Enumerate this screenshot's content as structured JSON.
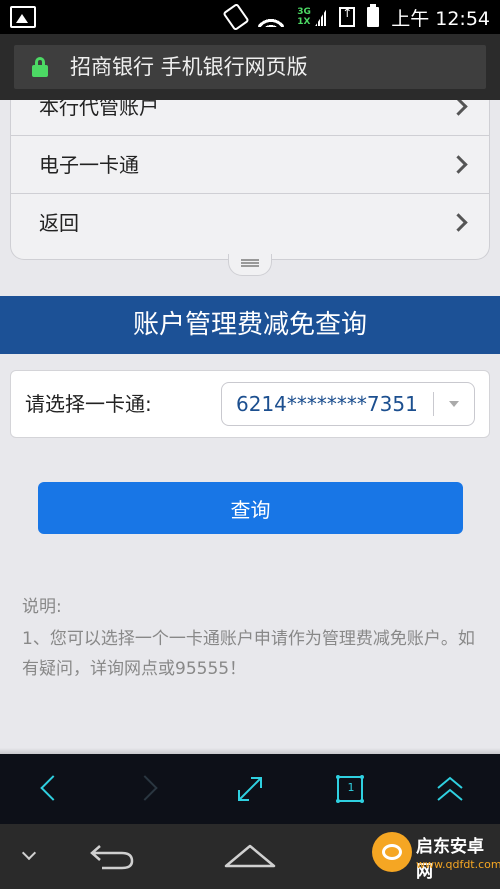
{
  "status_bar": {
    "time": "上午 12:54",
    "network_top": "3G",
    "network_bottom": "1X"
  },
  "browser": {
    "page_title": "招商银行 手机银行网页版"
  },
  "menu": {
    "items": [
      {
        "label": "本行代管账户"
      },
      {
        "label": "电子一卡通"
      },
      {
        "label": "返回"
      }
    ]
  },
  "header": {
    "title": "账户管理费减免查询"
  },
  "card_select": {
    "label": "请选择一卡通:",
    "value": "6214********7351"
  },
  "query_button": {
    "label": "查询"
  },
  "notes": {
    "title": "说明:",
    "body": "1、您可以选择一个一卡通账户申请作为管理费减免账户。如有疑问，详询网点或95555！"
  },
  "toolbar": {
    "tab_count": "1"
  },
  "watermark": {
    "name": "启东安卓网",
    "url": "www.qdfdt.com"
  },
  "colors": {
    "header_blue": "#1c5196",
    "button_blue": "#1876e6",
    "toolbar_accent": "#2fd0e0",
    "lock_green": "#4cd964"
  }
}
